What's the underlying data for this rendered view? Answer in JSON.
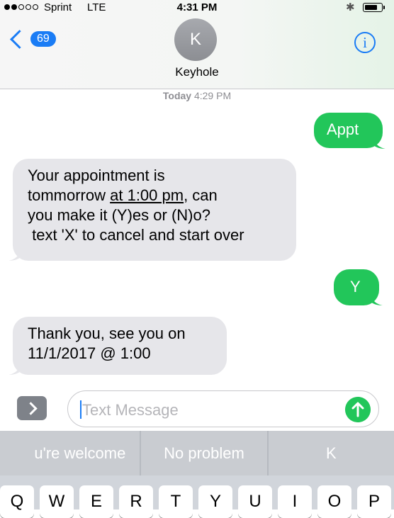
{
  "status_bar": {
    "carrier": "Sprint",
    "network": "LTE",
    "time": "4:31 PM",
    "signal_bars_filled": 2,
    "signal_bars_total": 5,
    "bluetooth_icon": "bluetooth-icon",
    "battery_level": 0.75
  },
  "header": {
    "back_count": "69",
    "avatar_initial": "K",
    "contact_name": "Keyhole",
    "info_icon": "i"
  },
  "timestamp": {
    "day": "Today",
    "time": "4:29 PM"
  },
  "messages": [
    {
      "direction": "outgoing",
      "text": "Appt"
    },
    {
      "direction": "incoming",
      "lines": [
        "Your appointment is",
        "tommorrow ",
        "at 1:00 pm",
        ", can",
        "you make it (Y)es or (N)o?",
        " text 'X' to cancel and start over"
      ]
    },
    {
      "direction": "outgoing",
      "text": "Y"
    },
    {
      "direction": "incoming",
      "lines": [
        "Thank you, see you on",
        "11/1/2017 @ 1:00"
      ]
    }
  ],
  "input": {
    "placeholder": "Text Message"
  },
  "suggestions": [
    "u're welcome",
    "No problem",
    "K"
  ],
  "keyboard_row": [
    "Q",
    "W",
    "E",
    "R",
    "T",
    "Y",
    "U",
    "I",
    "O",
    "P"
  ],
  "colors": {
    "accent": "#1a7cf5",
    "outgoing": "#22c65a",
    "incoming": "#e6e6ea"
  }
}
